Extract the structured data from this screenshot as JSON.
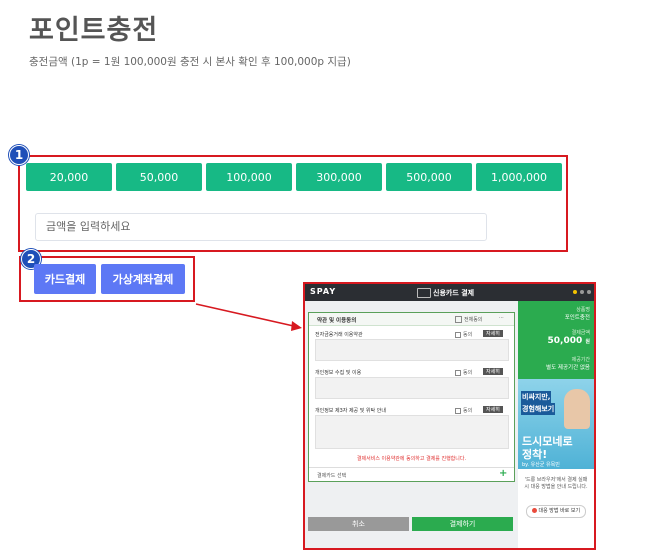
{
  "page": {
    "title": "포인트충전",
    "subtitle": "충전금액 (1p = 1원 100,000원 충전 시 본사 확인 후 100,000p 지급)"
  },
  "markers": {
    "one": "1",
    "two": "2"
  },
  "amounts": [
    "20,000",
    "50,000",
    "100,000",
    "300,000",
    "500,000",
    "1,000,000"
  ],
  "amount_input": {
    "placeholder": "금액을 입력하세요"
  },
  "payment_buttons": {
    "card": "카드결제",
    "virtual_account": "가상계좌결제"
  },
  "popup": {
    "logo": "SPAY",
    "title": "신용카드 결제",
    "terms_header": "약관 및 이용동의",
    "agree_all": "전체동의",
    "terms": [
      {
        "title": "전자금융거래 이용약관",
        "agree": "동의",
        "detail": "자세히"
      },
      {
        "title": "개인정보 수집 및 이용",
        "agree": "동의",
        "detail": "자세히"
      },
      {
        "title": "개인정보 제3자 제공 및 위탁 안내",
        "agree": "동의",
        "detail": "자세히"
      }
    ],
    "notice": "결제서비스 이용약관에 동의하고 결제를 진행합니다.",
    "card_select": "결제카드 선택",
    "cancel": "취소",
    "pay": "결제하기",
    "side": {
      "merchant_label": "상품명",
      "merchant_value": "포인트충전",
      "amount_label": "결제금액",
      "amount_value": "50,000",
      "amount_unit": "원",
      "period_label": "제공기간",
      "period_value": "별도 제공기간 없음",
      "ad_line1": "비싸지만,",
      "ad_line2": "경험해보기",
      "ad_line3": "드시모네로",
      "ad_line4": "정착!",
      "ad_by": "by. 유산균 유목민",
      "ad_caption": "'드롱 브라우저'에서 결제 실패 시 대응 방법을 안내 드립니다.",
      "ad_link": "대응 방법 바로 보기"
    }
  }
}
